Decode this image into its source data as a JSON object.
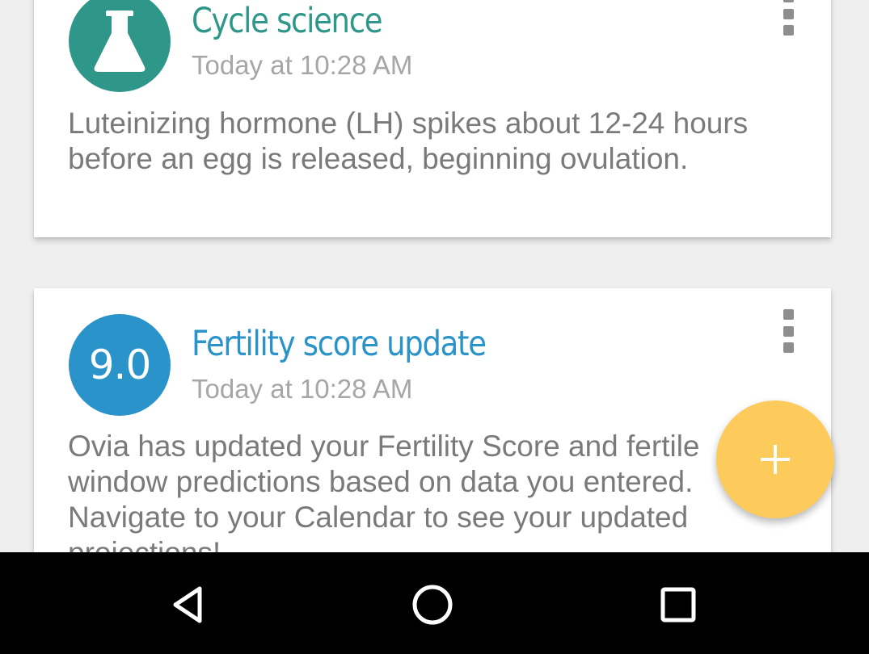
{
  "colors": {
    "teal": "#2e9789",
    "blue": "#2a93c9",
    "fab": "#fdcb5c",
    "nav_bar": "#000000",
    "background": "#efefef"
  },
  "feed": {
    "cards": [
      {
        "icon": "flask-icon",
        "title": "Cycle science",
        "time": "Today at 10:28 AM",
        "body": "Luteinizing hormone (LH) spikes about 12-24 hours before an egg is released, beginning ovulation."
      },
      {
        "score": "9.0",
        "title": "Fertility score update",
        "time": "Today at 10:28 AM",
        "body": "Ovia has updated your Fertility Score and fertile window predictions based on data you entered. Navigate to your Calendar to see your updated projections!"
      }
    ]
  },
  "fab": {
    "icon": "plus-icon"
  },
  "nav": {
    "back_icon": "back-triangle-icon",
    "home_icon": "home-circle-icon",
    "recents_icon": "recents-square-icon"
  }
}
